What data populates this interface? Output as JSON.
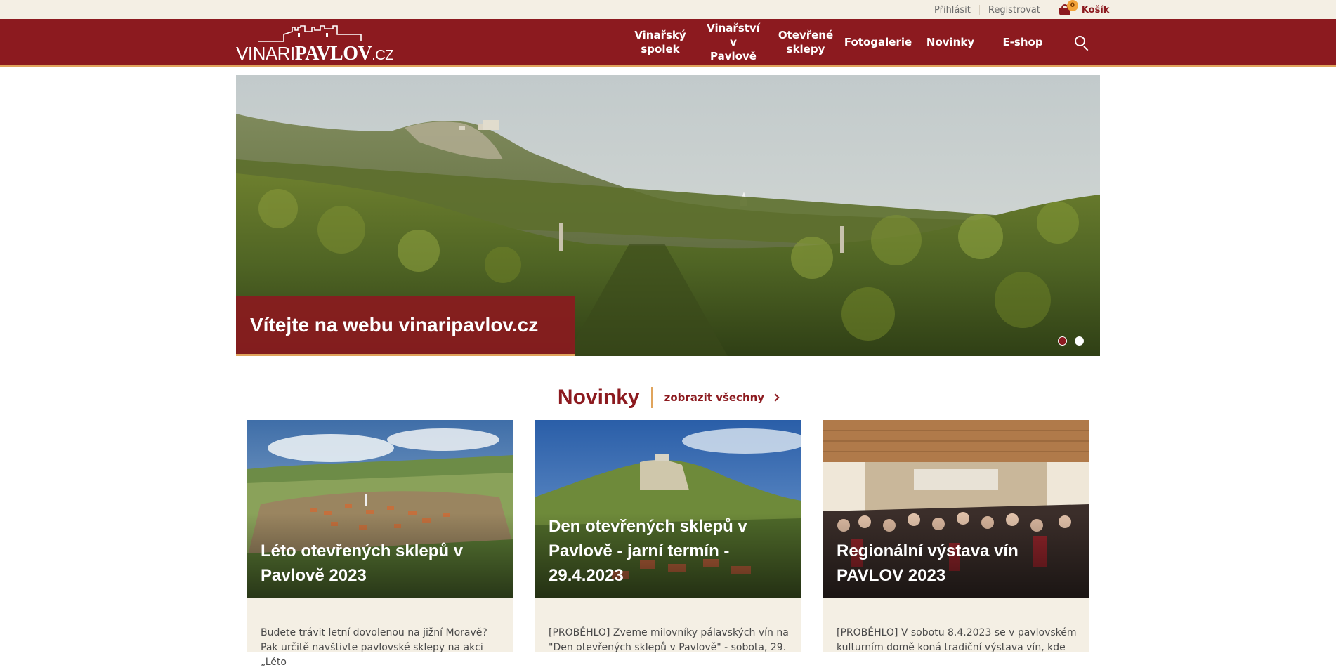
{
  "topbar": {
    "login": "Přihlásit",
    "register": "Registrovat",
    "cart_label": "Košík",
    "cart_count": "0"
  },
  "logo": {
    "part1": "VINARI",
    "part2": "PAVLOV",
    "part3": ".CZ"
  },
  "nav": {
    "items": [
      {
        "label": "Vinařský spolek"
      },
      {
        "label": "Vinařství v Pavlově"
      },
      {
        "label": "Otevřené sklepy"
      },
      {
        "label": "Fotogalerie"
      },
      {
        "label": "Novinky"
      },
      {
        "label": "E-shop"
      }
    ]
  },
  "hero": {
    "caption": "Vítejte na webu vinaripavlov.cz",
    "slides_total": 2,
    "active_slide": 1
  },
  "news": {
    "title": "Novinky",
    "show_all": "zobrazit všechny",
    "cards": [
      {
        "title": "Léto otevřených sklepů v Pavlově 2023",
        "excerpt": "Budete trávit letní dovolenou na jižní Moravě? Pak určitě navštivte pavlovské sklepy na akci „Léto"
      },
      {
        "title": "Den otevřených sklepů v Pavlově - jarní termín - 29.4.2023",
        "excerpt": "[PROBĚHLO] Zveme milovníky pálavských vín na \"Den otevřených sklepů v Pavlově\" - sobota, 29."
      },
      {
        "title": "Regionální výstava vín PAVLOV 2023",
        "excerpt": "[PROBĚHLO] V sobotu 8.4.2023 se v pavlovském kulturním domě koná tradiční výstava vín, kde"
      }
    ]
  },
  "colors": {
    "brand": "#8c1a1f",
    "accent": "#e0a45c",
    "cream": "#f4efe4"
  }
}
